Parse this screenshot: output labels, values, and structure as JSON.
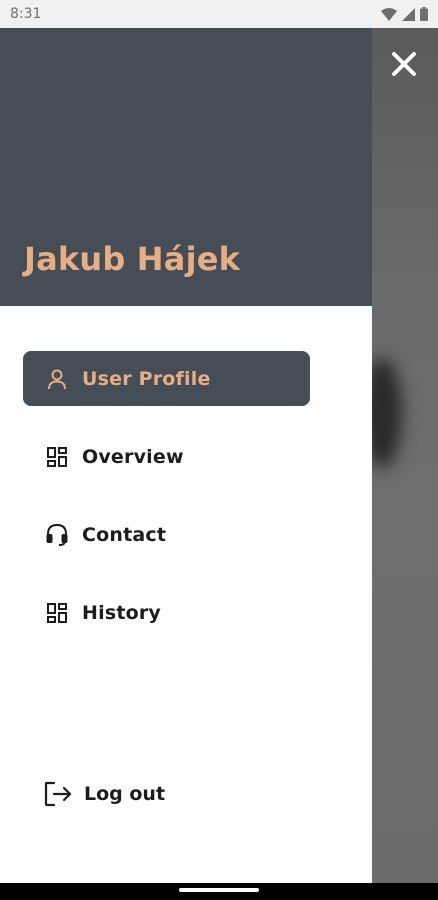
{
  "status_bar": {
    "time": "8:31"
  },
  "drawer": {
    "user_name": "Jakub Hájek",
    "menu": [
      {
        "label": "User Profile",
        "icon": "person-icon",
        "active": true
      },
      {
        "label": "Overview",
        "icon": "dashboard-icon",
        "active": false
      },
      {
        "label": "Contact",
        "icon": "headset-icon",
        "active": false
      },
      {
        "label": "History",
        "icon": "dashboard-icon",
        "active": false
      }
    ],
    "logout_label": "Log out"
  },
  "colors": {
    "header_bg": "#454e57",
    "accent": "#e7ad83",
    "text": "#1c1c1c"
  }
}
